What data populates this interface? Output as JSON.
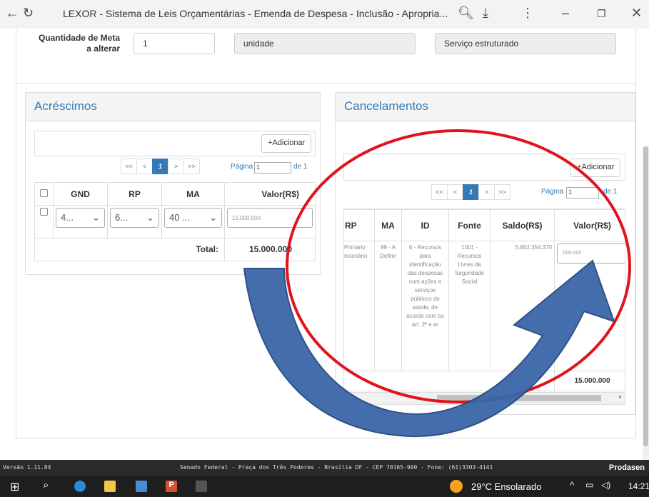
{
  "browser": {
    "title": "LEXOR - Sistema de Leis Orçamentárias - Emenda de Despesa - Inclusão - Apropria..."
  },
  "meta": {
    "label_line1": "Quantidade de Meta",
    "label_line2": "a alterar",
    "quantity": "1",
    "unit": "unidade",
    "product": "Serviço estruturado"
  },
  "acrescimos": {
    "title": "Acréscimos",
    "add_label": "Adicionar",
    "pager": [
      "<<",
      "<",
      "1",
      ">",
      ">>"
    ],
    "page_label": "Página",
    "page_value": "1",
    "page_of": "de 1",
    "columns": [
      "GND",
      "RP",
      "MA",
      "Valor(R$)"
    ],
    "row": {
      "gnd": "4...",
      "rp": "6...",
      "ma": "40 ...",
      "valor": "15.000.000"
    },
    "total_label": "Total:",
    "total_value": "15.000.000"
  },
  "cancelamentos": {
    "title": "Cancelamentos",
    "add_label": "Adicionar",
    "pager": [
      "<<",
      "<",
      "1",
      ">",
      ">>"
    ],
    "page_label": "Página",
    "page_value": "1",
    "page_of": "de 1",
    "columns": [
      "RP",
      "MA",
      "ID",
      "Fonte",
      "Saldo(R$)",
      "Valor(R$)"
    ],
    "row": {
      "rp": "Primário ricionário",
      "ma": "99 - A Definir",
      "id": "6 - Recursos para identificação das despesas com ações e serviços públicos de saúde, de acordo com os art. 2º e ar",
      "fonte": "1001 - Recursos Livres da Seguridade Social",
      "saldo": "5.852.354.370",
      "valor": ",000.000"
    },
    "total_value": "15.000.000"
  },
  "footer": {
    "version": "Versão 1.11.84",
    "address": "Senado Federal - Praça dos Três Poderes - Brasília DF - CEP 70165-900 - Fone: (61)3303-4141",
    "brand": "Prodasen"
  },
  "taskbar": {
    "weather": "29°C  Ensolarado",
    "time": "14:21"
  },
  "colors": {
    "link_blue": "#337ab7",
    "circle_red": "#e0141c",
    "arrow_blue": "#3a66a8"
  }
}
